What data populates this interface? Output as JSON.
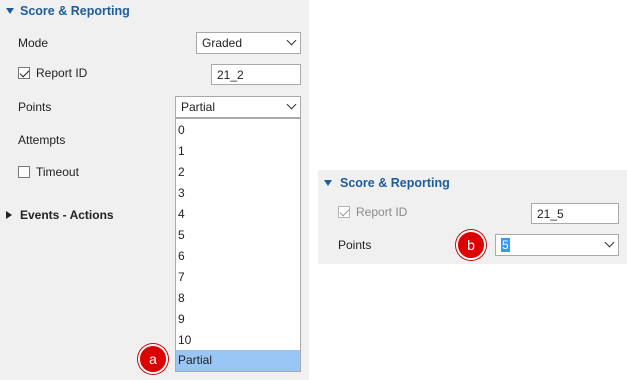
{
  "panel_a": {
    "section_title": "Score & Reporting",
    "mode_label": "Mode",
    "mode_value": "Graded",
    "report_id_label": "Report ID",
    "report_id_checked": true,
    "report_id_value": "21_2",
    "points_label": "Points",
    "points_value": "Partial",
    "attempts_label": "Attempts",
    "timeout_label": "Timeout",
    "timeout_checked": false,
    "events_title": "Events - Actions",
    "dropdown_options": [
      "0",
      "1",
      "2",
      "3",
      "4",
      "5",
      "6",
      "7",
      "8",
      "9",
      "10",
      "Partial"
    ],
    "dropdown_selected": "Partial",
    "badge": "a"
  },
  "panel_b": {
    "section_title": "Score & Reporting",
    "report_id_label": "Report ID",
    "report_id_checked": true,
    "report_id_disabled": true,
    "report_id_value": "21_5",
    "points_label": "Points",
    "points_value": "5",
    "badge": "b"
  },
  "colors": {
    "panel_bg": "#f0f0f0",
    "section_title": "#1d5c9c",
    "selected_option": "#99c6f5",
    "badge": "#dd0000",
    "text_highlight": "#3399ff"
  }
}
